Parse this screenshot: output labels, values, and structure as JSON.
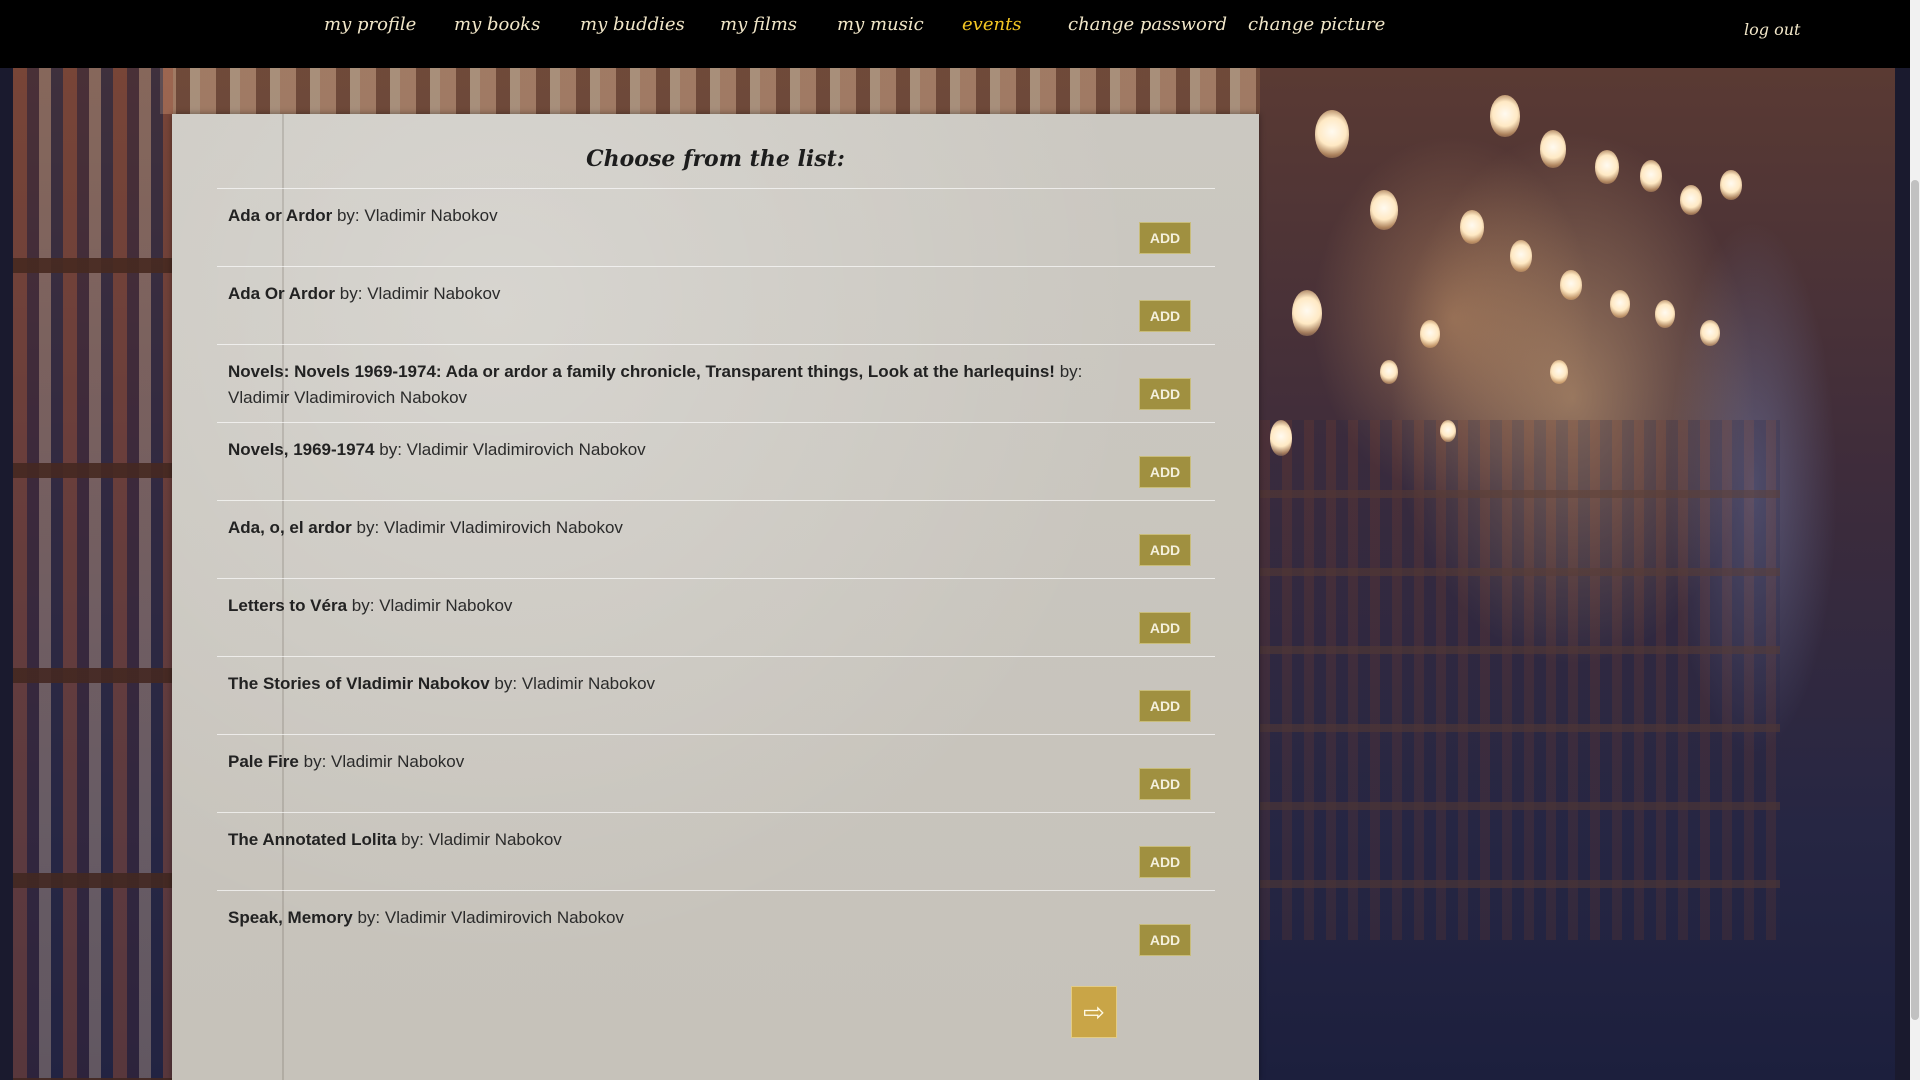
{
  "nav": {
    "items": [
      {
        "label": "my profile"
      },
      {
        "label": "my books"
      },
      {
        "label": "my buddies"
      },
      {
        "label": "my films"
      },
      {
        "label": "my music"
      },
      {
        "label": "events"
      },
      {
        "label": "change password"
      },
      {
        "label": "change picture"
      }
    ],
    "active": "events",
    "logout": "log out"
  },
  "panel": {
    "title": "Choose from the list:",
    "by_label": "by:",
    "add_label": "ADD",
    "next_icon": "⇨",
    "books": [
      {
        "title": "Ada or Ardor",
        "author": "Vladimir Nabokov"
      },
      {
        "title": "Ada Or Ardor",
        "author": "Vladimir Nabokov"
      },
      {
        "title": "Novels: Novels 1969-1974: Ada or ardor a family chronicle, Transparent things, Look at the harlequins!",
        "author": "Vladimir Vladimirovich Nabokov"
      },
      {
        "title": "Novels, 1969-1974",
        "author": "Vladimir Vladimirovich Nabokov"
      },
      {
        "title": "Ada, o, el ardor",
        "author": "Vladimir Vladimirovich Nabokov"
      },
      {
        "title": "Letters to Véra",
        "author": "Vladimir Nabokov"
      },
      {
        "title": "The Stories of Vladimir Nabokov",
        "author": "Vladimir Nabokov"
      },
      {
        "title": "Pale Fire",
        "author": "Vladimir Nabokov"
      },
      {
        "title": "The Annotated Lolita",
        "author": "Vladimir Nabokov"
      },
      {
        "title": "Speak, Memory",
        "author": "Vladimir Vladimirovich Nabokov"
      }
    ]
  },
  "colors": {
    "nav_bg": "#000000",
    "nav_text": "#f1e6c8",
    "nav_active": "#f3c623",
    "add_button": "#a09040",
    "next_button": "#c9a547"
  },
  "icons": {
    "next": "right-arrow-icon"
  }
}
